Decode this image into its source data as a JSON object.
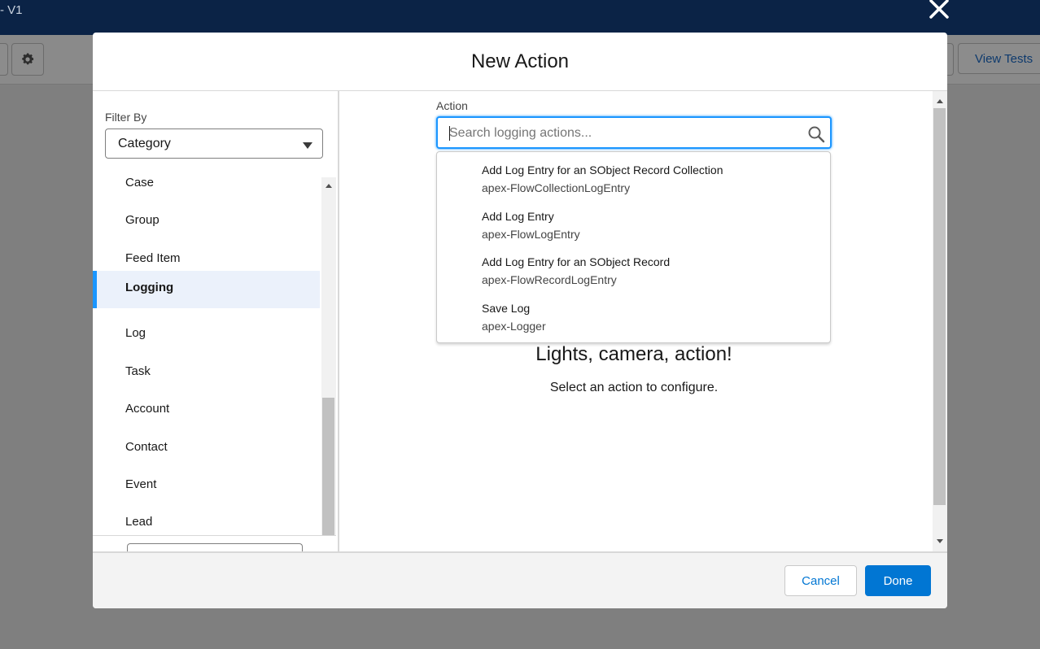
{
  "app": {
    "title": "- V1"
  },
  "background": {
    "view_tests_label": "View Tests"
  },
  "modal": {
    "title": "New Action",
    "filter": {
      "label": "Filter By",
      "value": "Category"
    },
    "categories": [
      {
        "label": "Case"
      },
      {
        "label": "Group"
      },
      {
        "label": "Feed Item"
      },
      {
        "label": "Logging",
        "selected": true
      },
      {
        "label": "Log"
      },
      {
        "label": "Task"
      },
      {
        "label": "Account"
      },
      {
        "label": "Contact"
      },
      {
        "label": "Event"
      },
      {
        "label": "Lead"
      }
    ],
    "action": {
      "label": "Action",
      "placeholder": "Search logging actions...",
      "value": "",
      "results": [
        {
          "title": "Add Log Entry for an SObject Record Collection",
          "api_name": "apex-FlowCollectionLogEntry"
        },
        {
          "title": "Add Log Entry",
          "api_name": "apex-FlowLogEntry"
        },
        {
          "title": "Add Log Entry for an SObject Record",
          "api_name": "apex-FlowRecordLogEntry"
        },
        {
          "title": "Save Log",
          "api_name": "apex-Logger"
        }
      ]
    },
    "empty_state": {
      "title": "Lights, camera, action!",
      "description": "Select an action to configure."
    },
    "footer": {
      "cancel_label": "Cancel",
      "done_label": "Done"
    }
  },
  "colors": {
    "brand": "#0176d3",
    "focus": "#1b96ff",
    "header_bg": "#0b2346",
    "selected_bg": "#ebf1fb"
  }
}
